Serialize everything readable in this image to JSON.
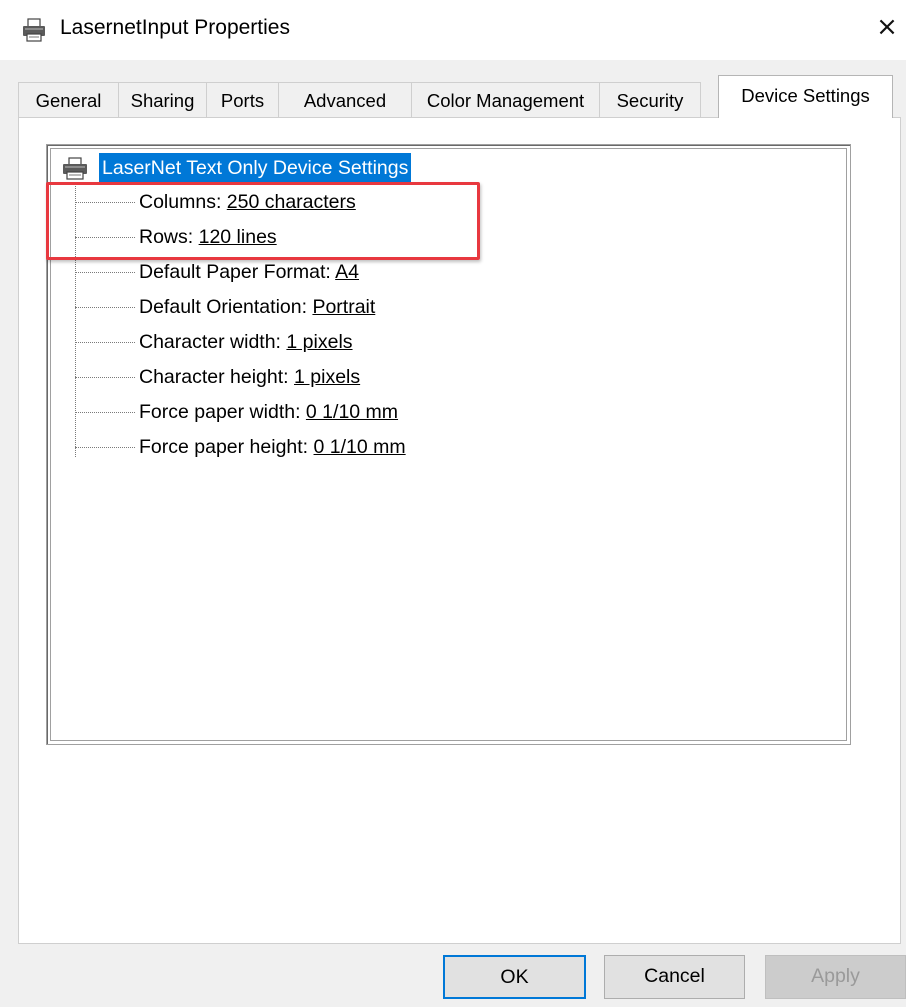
{
  "window": {
    "title": "LasernetInput Properties",
    "close_label": "×"
  },
  "tabs": [
    {
      "label": "General"
    },
    {
      "label": "Sharing"
    },
    {
      "label": "Ports"
    },
    {
      "label": "Advanced"
    },
    {
      "label": "Color Management"
    },
    {
      "label": "Security"
    },
    {
      "label": "Device Settings",
      "selected": true
    }
  ],
  "tree": {
    "root_label": "LaserNet Text Only Device Settings",
    "root_icon": "printer-icon",
    "items": [
      {
        "label": "Columns: ",
        "value": "250 characters"
      },
      {
        "label": "Rows: ",
        "value": "120 lines"
      },
      {
        "label": "Default Paper Format: ",
        "value": "A4"
      },
      {
        "label": "Default Orientation: ",
        "value": "Portrait"
      },
      {
        "label": "Character width: ",
        "value": "1 pixels"
      },
      {
        "label": "Character height: ",
        "value": "1 pixels"
      },
      {
        "label": "Force paper width: ",
        "value": "0 1/10 mm"
      },
      {
        "label": "Force paper height: ",
        "value": "0 1/10 mm"
      }
    ]
  },
  "buttons": {
    "ok": "OK",
    "cancel": "Cancel",
    "apply": "Apply"
  },
  "colors": {
    "selection": "#0078d7",
    "highlight_annotation": "#e8383f"
  }
}
